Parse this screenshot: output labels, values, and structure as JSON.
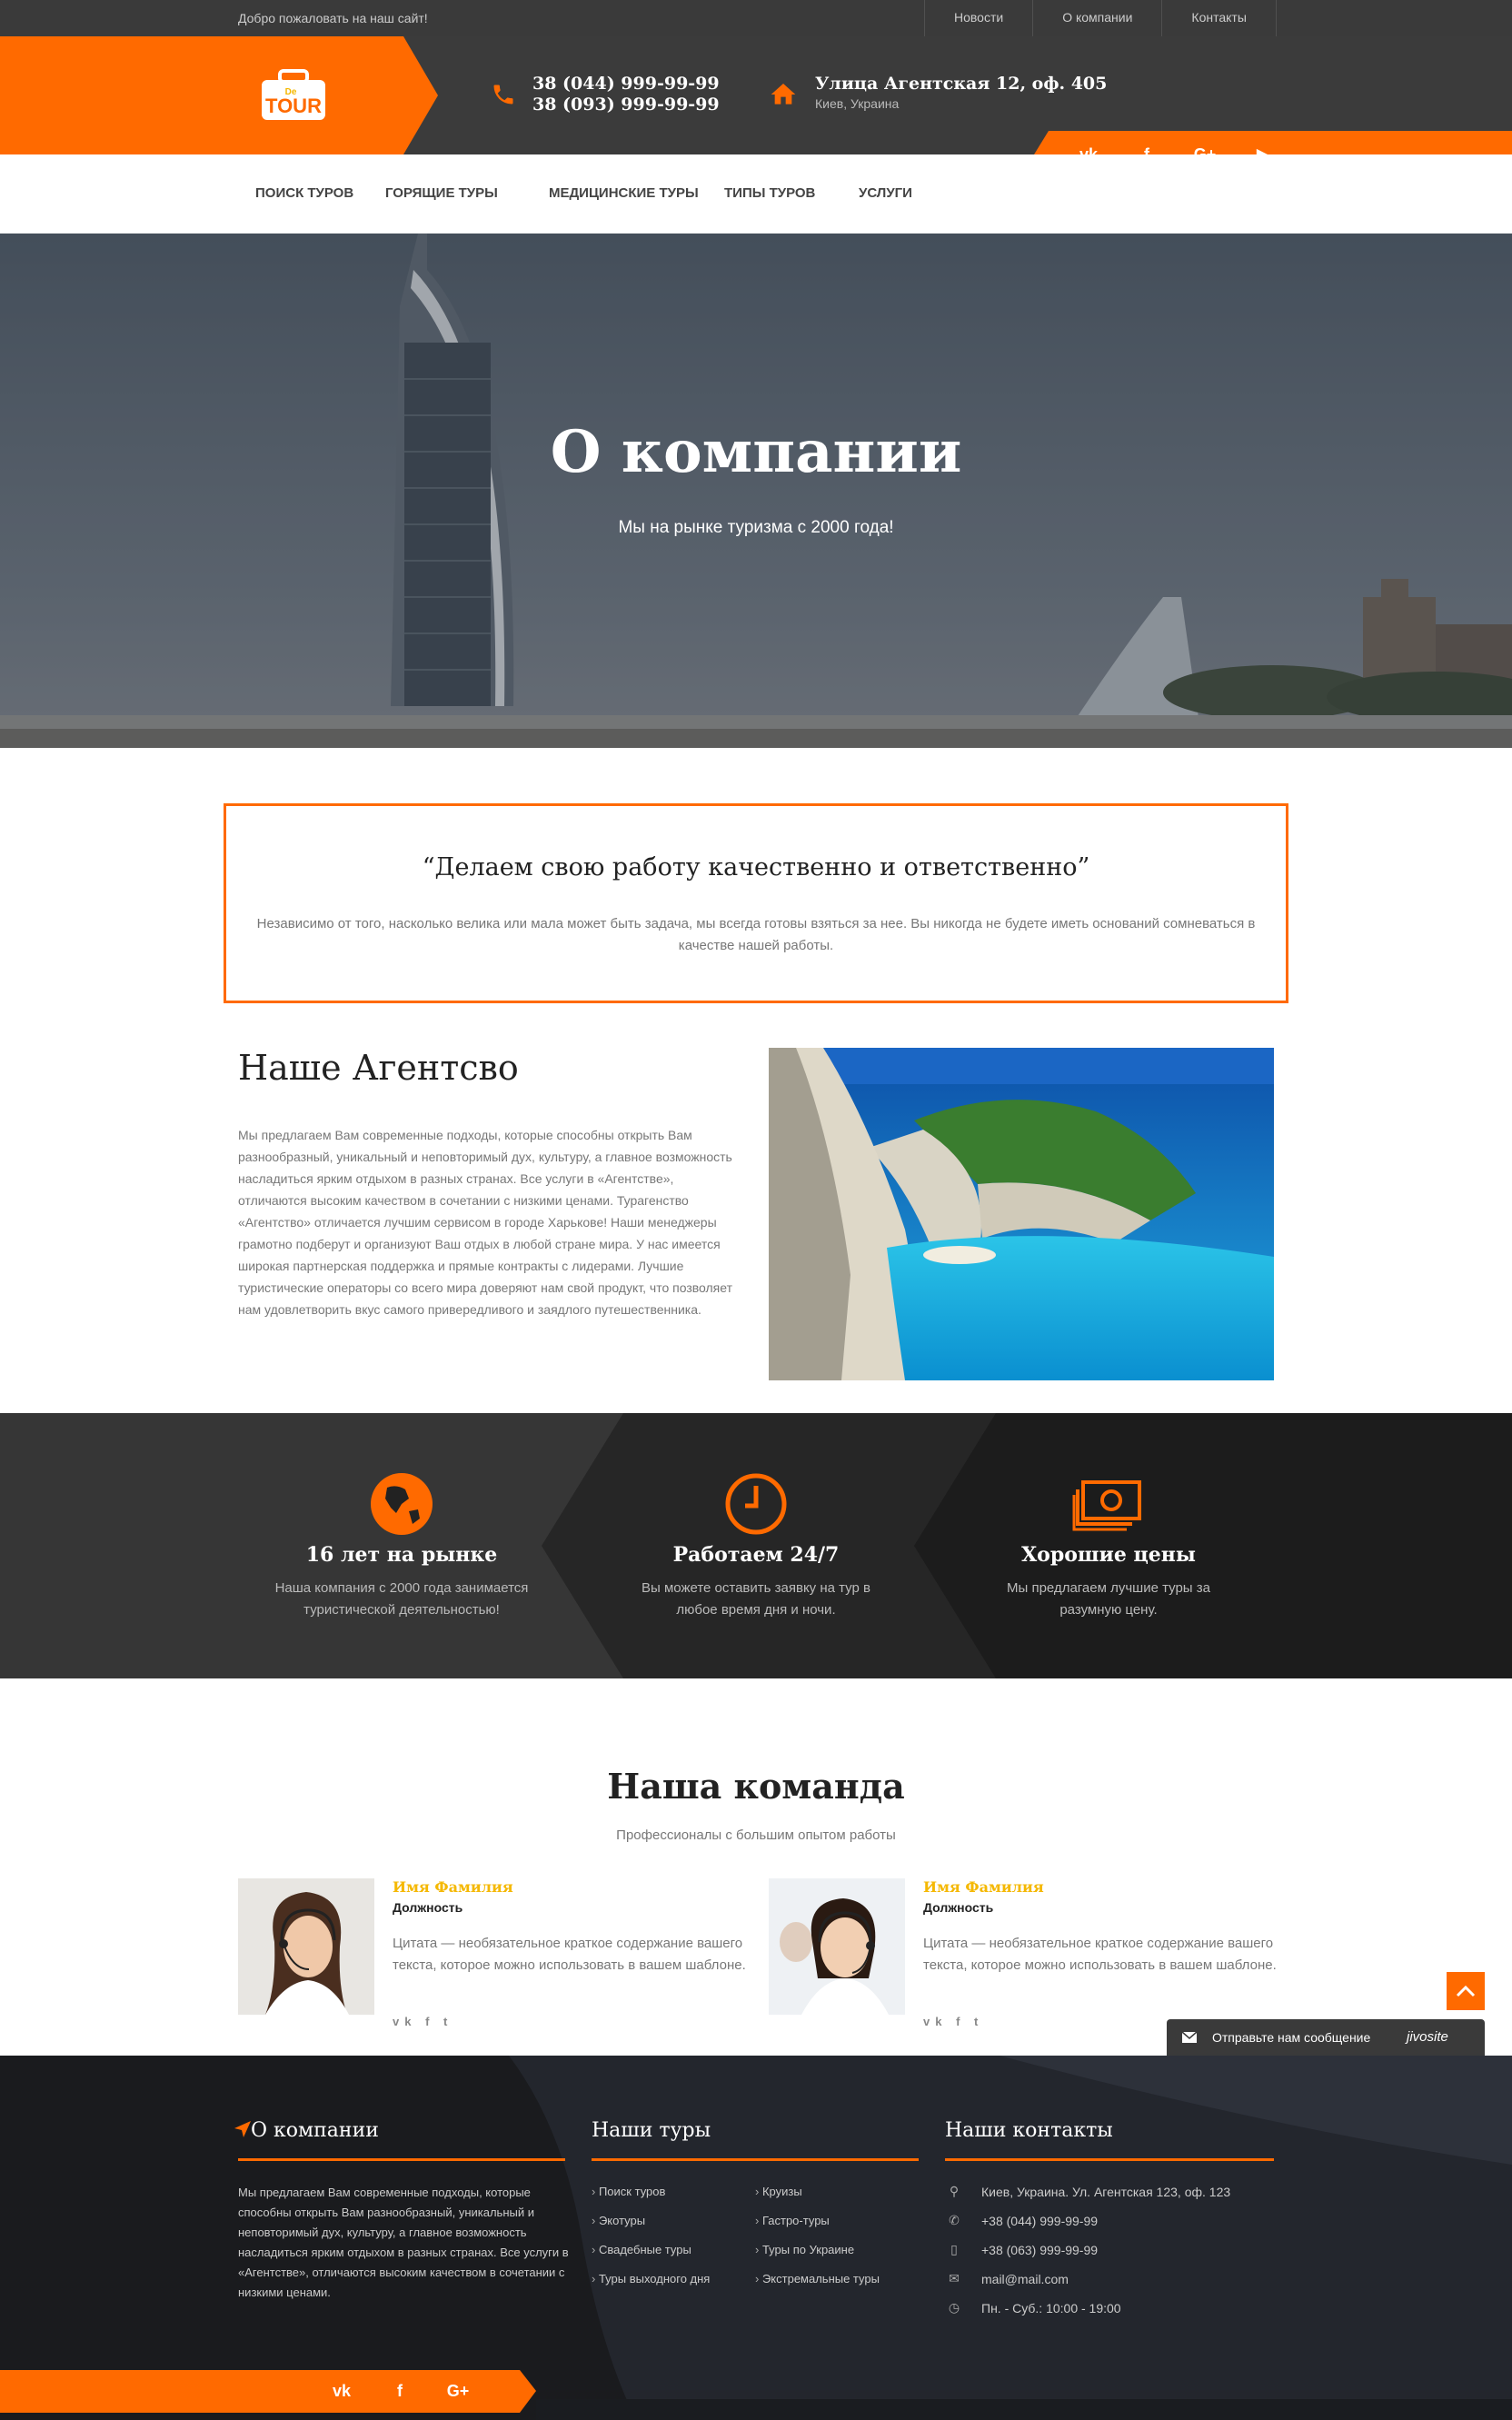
{
  "topbar": {
    "welcome": "Добро пожаловать на наш сайт!",
    "links": [
      "Новости",
      "О компании",
      "Контакты"
    ]
  },
  "header": {
    "logo_text": "TOUR",
    "logo_small": "De",
    "phone1": "38 (044) 999-99-99",
    "phone2": "38 (093) 999-99-99",
    "address": "Улица Агентская 12, оф. 405",
    "city": "Киев, Украина",
    "social": [
      "vk",
      "f",
      "G+",
      "▶"
    ]
  },
  "nav": [
    "ПОИСК ТУРОВ",
    "ГОРЯЩИЕ ТУРЫ",
    "МЕДИЦИНСКИЕ ТУРЫ",
    "ТИПЫ ТУРОВ",
    "УСЛУГИ"
  ],
  "hero": {
    "title": "О компании",
    "subtitle": "Мы на рынке туризма с 2000 года!"
  },
  "quote": {
    "title": "“Делаем свою работу качественно и ответственно”",
    "text": "Независимо от того, насколько велика или мала может быть задача, мы всегда готовы взяться за нее. Вы никогда не будете иметь оснований сомневаться в качестве нашей работы."
  },
  "agency": {
    "title": "Наше Агентсво",
    "text": "Мы предлагаем Вам современные подходы, которые способны открыть Вам разнообразный, уникальный и неповторимый дух, культуру, а главное возможность насладиться ярким отдыхом в разных странах. Все услуги в «Агентстве», отличаются высоким качеством в сочетании с низкими ценами. Турагенство «Агентство» отличается лучшим сервисом в городе Харькове! Наши менеджеры грамотно подберут и организуют Ваш отдых в любой стране мира. У нас имеется широкая партнерская поддержка и прямые контракты с лидерами. Лучшие туристические операторы со всего мира доверяют нам свой продукт, что позволяет нам удовлетворить вкус самого привередливого и заядлого путешественника."
  },
  "features": [
    {
      "title": "16 лет на рынке",
      "text": "Наша компания с 2000 года занимается туристической деятельностью!",
      "icon": "globe-icon"
    },
    {
      "title": "Работаем 24/7",
      "text": "Вы можете оставить заявку на тур в любое время дня и ночи.",
      "icon": "clock-icon"
    },
    {
      "title": "Хорошие цены",
      "text": "Мы предлагаем лучшие туры за разумную цену.",
      "icon": "money-icon"
    }
  ],
  "team": {
    "title": "Наша команда",
    "subtitle": "Профессионалы с большим опытом работы",
    "members": [
      {
        "name": "Имя Фамилия",
        "role": "Должность",
        "quote": "Цитата — необязательное краткое содержание вашего текста, которое можно использовать в вашем шаблоне.",
        "social": "vk f t"
      },
      {
        "name": "Имя Фамилия",
        "role": "Должность",
        "quote": "Цитата — необязательное краткое содержание вашего текста, которое можно использовать в вашем шаблоне.",
        "social": "vk f t"
      }
    ]
  },
  "chat": {
    "label": "Отправьте нам сообщение",
    "brand": "jivosite"
  },
  "footer": {
    "about_title": "О компании",
    "about_text": "Мы предлагаем Вам современные подходы, которые способны открыть Вам разнообразный, уникальный и неповторимый дух, культуру, а главное возможность насладиться ярким отдыхом в разных странах. Все услуги в «Агентстве», отличаются высоким качеством в сочетании с низкими ценами.",
    "tours_title": "Наши туры",
    "tours_col1": [
      "Поиск туров",
      "Экотуры",
      "Свадебные туры",
      "Туры выходного дня"
    ],
    "tours_col2": [
      "Круизы",
      "Гастро-туры",
      "Туры по Украине",
      "Экстремальные туры"
    ],
    "contacts_title": "Наши контакты",
    "contacts": [
      {
        "icon": "map-pin-icon",
        "text": "Киев, Украина. Ул. Агентская 123, оф. 123"
      },
      {
        "icon": "phone-icon",
        "text": "+38 (044) 999-99-99"
      },
      {
        "icon": "mobile-icon",
        "text": "+38 (063) 999-99-99"
      },
      {
        "icon": "envelope-icon",
        "text": "mail@mail.com"
      },
      {
        "icon": "clock-icon",
        "text": "Пн. - Суб.: 10:00 - 19:00"
      }
    ]
  },
  "colors": {
    "accent": "#ff6a00",
    "dark": "#3b3b3b",
    "gold": "#f5b800"
  }
}
